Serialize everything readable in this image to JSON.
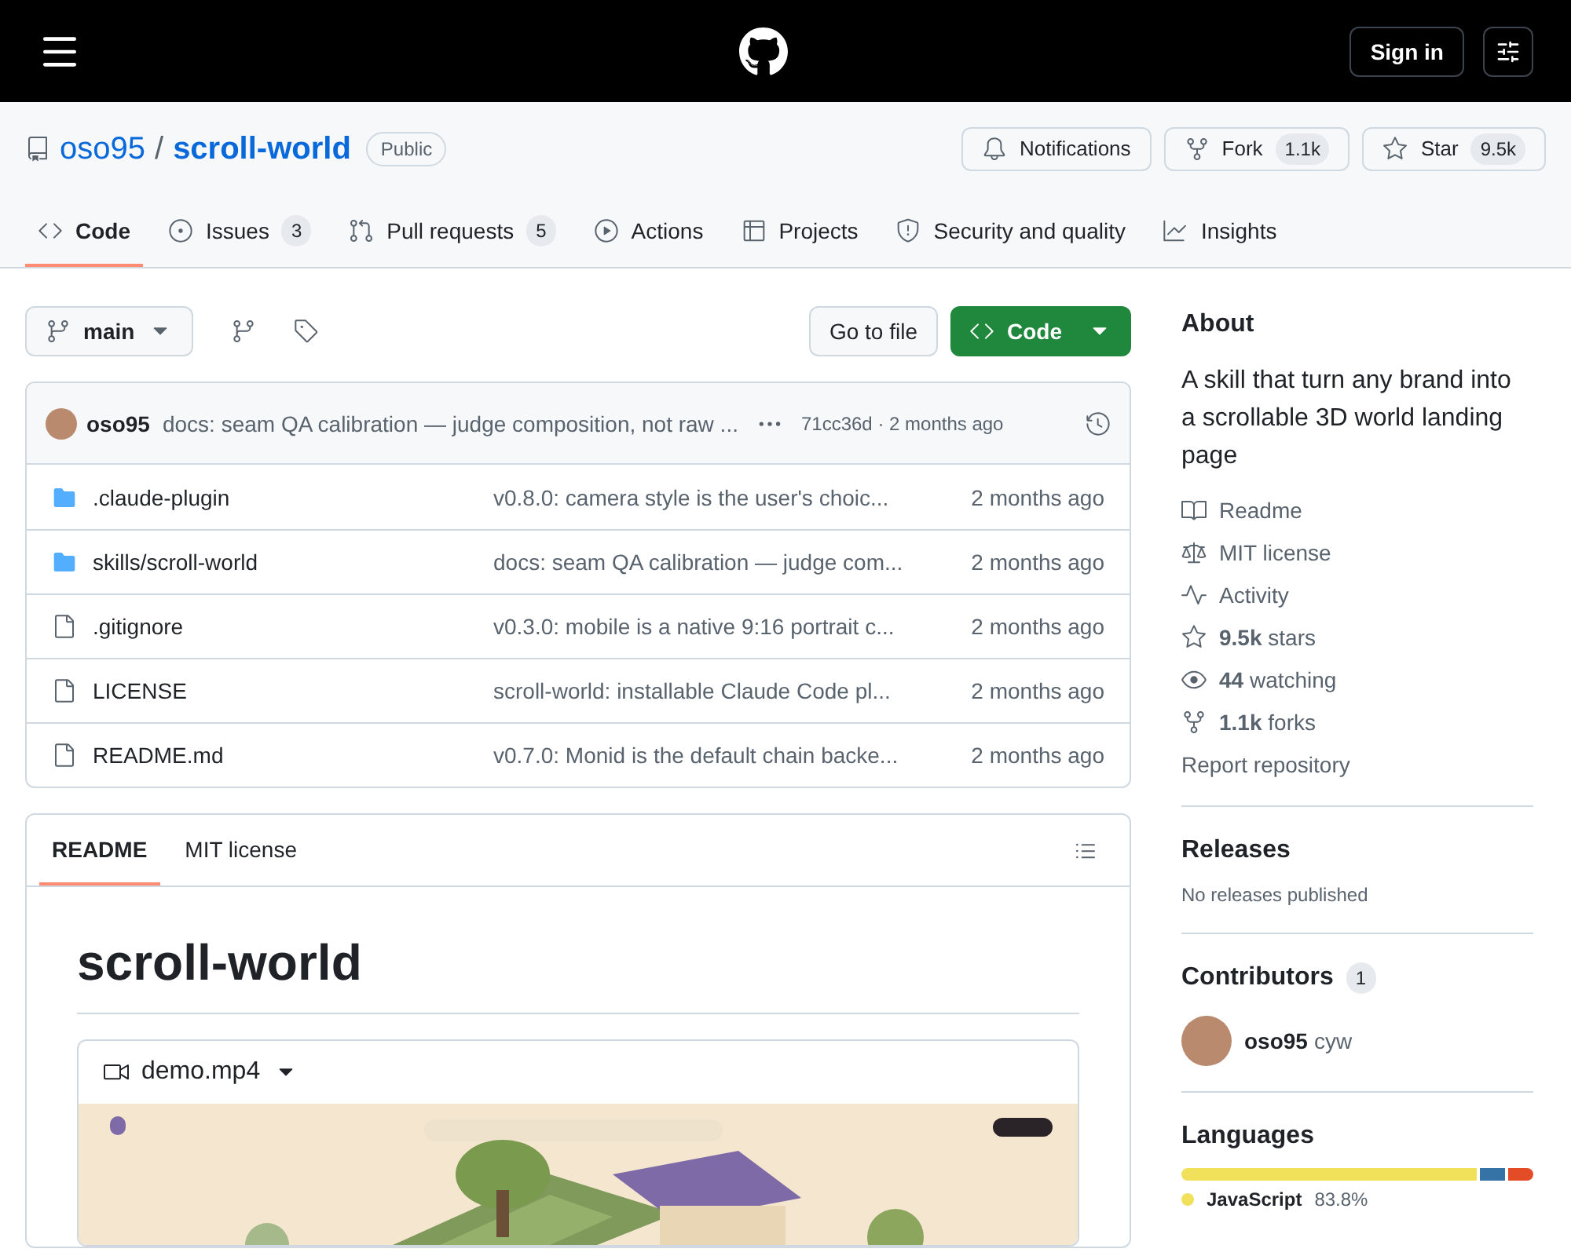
{
  "header": {
    "sign_in": "Sign in"
  },
  "repo": {
    "owner": "oso95",
    "separator": "/",
    "name": "scroll-world",
    "visibility": "Public"
  },
  "actions": [
    {
      "kind": "notifications",
      "label": "Notifications"
    },
    {
      "kind": "fork",
      "label": "Fork",
      "count": "1.1k"
    },
    {
      "kind": "star",
      "label": "Star",
      "count": "9.5k"
    }
  ],
  "tabs": [
    {
      "kind": "code",
      "label": "Code",
      "selected": true
    },
    {
      "kind": "issues",
      "label": "Issues",
      "count": "3",
      "selected": false
    },
    {
      "kind": "pulls",
      "label": "Pull requests",
      "count": "5",
      "selected": false
    },
    {
      "kind": "actions",
      "label": "Actions",
      "selected": false
    },
    {
      "kind": "projects",
      "label": "Projects",
      "selected": false
    },
    {
      "kind": "security",
      "label": "Security and quality",
      "selected": false
    },
    {
      "kind": "insights",
      "label": "Insights",
      "selected": false
    }
  ],
  "toolbar": {
    "branch": "main",
    "go_to_file": "Go to file",
    "code_button": "Code"
  },
  "latest_commit": {
    "author": "oso95",
    "message": "docs: seam QA calibration — judge composition, not raw ...",
    "meta": "71cc36d · 2 months ago"
  },
  "files": [
    {
      "kind": "folder",
      "name": ".claude-plugin",
      "message": "v0.8.0: camera style is the user's choic...",
      "age": "2 months ago"
    },
    {
      "kind": "folder",
      "name": "skills/scroll-world",
      "message": "docs: seam QA calibration — judge com...",
      "age": "2 months ago"
    },
    {
      "kind": "file",
      "name": ".gitignore",
      "message": "v0.3.0: mobile is a native 9:16 portrait c...",
      "age": "2 months ago"
    },
    {
      "kind": "file",
      "name": "LICENSE",
      "message": "scroll-world: installable Claude Code pl...",
      "age": "2 months ago"
    },
    {
      "kind": "file",
      "name": "README.md",
      "message": "v0.7.0: Monid is the default chain backe...",
      "age": "2 months ago"
    }
  ],
  "readme": {
    "tabs": [
      {
        "label": "README",
        "selected": true
      },
      {
        "label": "MIT license",
        "selected": false
      }
    ],
    "title": "scroll-world",
    "video": {
      "name": "demo.mp4"
    }
  },
  "about": {
    "title": "About",
    "description": "A skill that turn any brand into a scrollable 3D world landing page",
    "links": [
      {
        "kind": "readme",
        "text": "Readme"
      },
      {
        "kind": "license",
        "text": "MIT license"
      },
      {
        "kind": "activity",
        "text": "Activity"
      },
      {
        "kind": "stars",
        "text": "**9.5k** stars"
      },
      {
        "kind": "watching",
        "text": "**44** watching"
      },
      {
        "kind": "forks",
        "text": "**1.1k** forks"
      },
      {
        "kind": "report",
        "text": "Report repository"
      }
    ]
  },
  "releases": {
    "title": "Releases",
    "note": "No releases published"
  },
  "contributors": {
    "title": "Contributors",
    "count": "1",
    "people": [
      {
        "login": "oso95",
        "name": "cyw"
      }
    ]
  },
  "languages": {
    "title": "Languages",
    "segments": [
      {
        "color": "#f1e05a",
        "level": 0.838
      },
      {
        "color": "#3572a5"
      },
      {
        "color": "#e34c26"
      }
    ],
    "items": [
      {
        "name": "JavaScript",
        "share": "83.8%",
        "color": "#f1e05a"
      }
    ]
  }
}
